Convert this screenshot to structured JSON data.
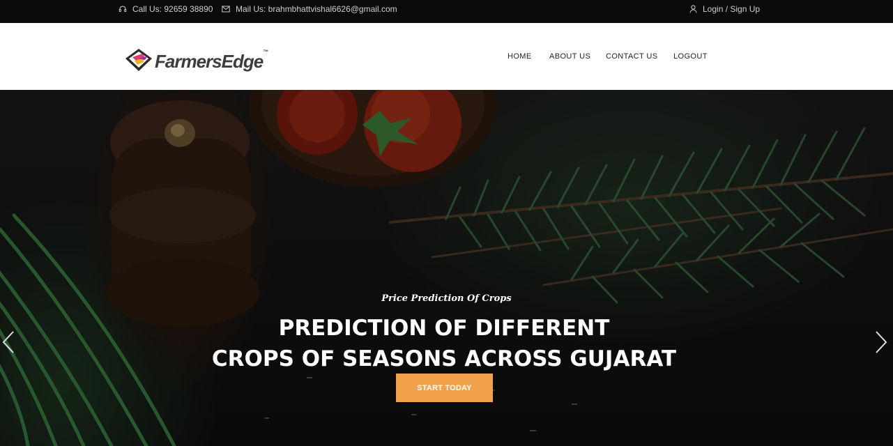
{
  "topbar": {
    "phone": "Call Us: 92659 38890",
    "mail": "Mail Us: brahmbhattvishal6626@gmail.com",
    "login": "Login / Sign Up"
  },
  "header": {
    "logo_text": "FarmersEdge",
    "logo_tm": "™",
    "nav": {
      "home": "HOME",
      "about": "ABOUT US",
      "contact": "CONTACT US",
      "logout": "LOGOUT"
    }
  },
  "hero": {
    "subtitle": "Price Prediction Of Crops",
    "title_line1": "PREDICTION OF DIFFERENT",
    "title_line2": "CROPS OF SEASONS ACROSS GUJARAT",
    "cta": "START TODAY"
  },
  "colors": {
    "topbar_bg": "#0b0b0b",
    "cta": "#f2a24a",
    "header_bg": "#ffffff"
  },
  "icons": [
    "headset-icon",
    "mail-icon",
    "user-icon",
    "chevron-left-icon",
    "chevron-right-icon"
  ]
}
